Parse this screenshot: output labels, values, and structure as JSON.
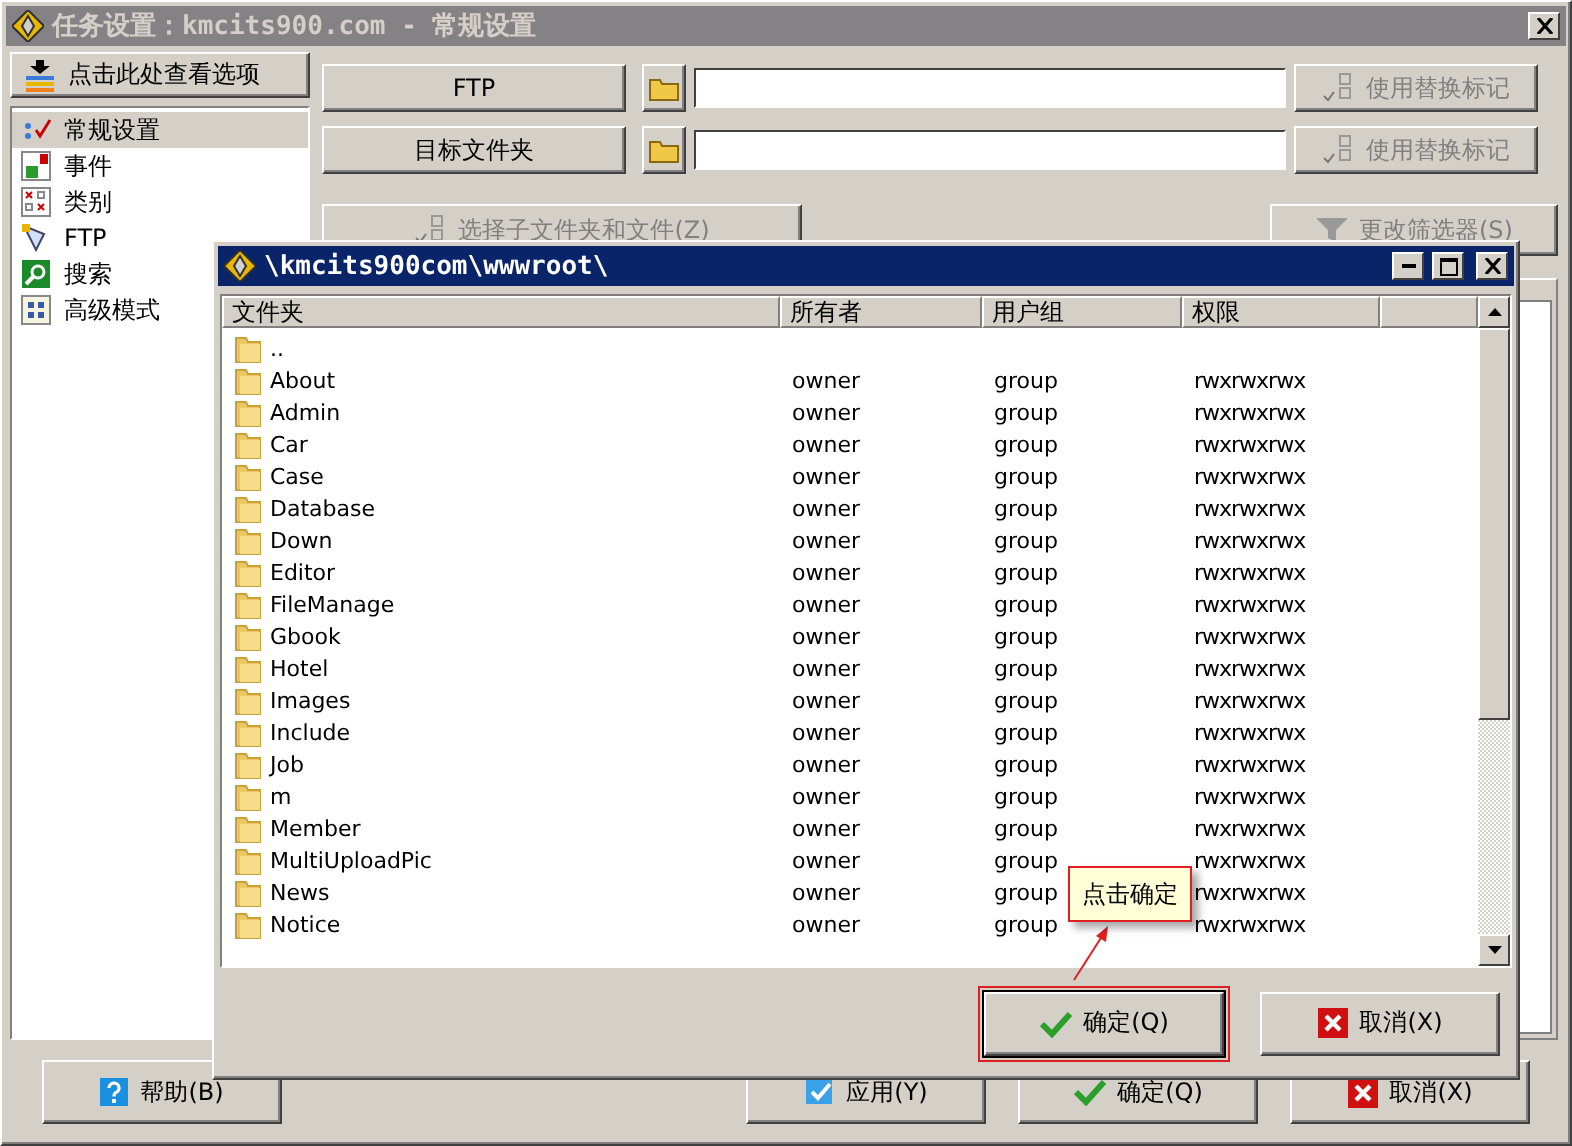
{
  "main_window": {
    "title": "任务设置：kmcits900.com - 常规设置",
    "active": false,
    "options_button": "点击此处查看选项",
    "nav_items": [
      {
        "label": "常规设置",
        "selected": true
      },
      {
        "label": "事件",
        "selected": false
      },
      {
        "label": "类别",
        "selected": false
      },
      {
        "label": "FTP",
        "selected": false
      },
      {
        "label": "搜索",
        "selected": false
      },
      {
        "label": "高级模式",
        "selected": false
      }
    ],
    "fields": [
      {
        "button": "FTP",
        "replace_button": {
          "label": "使用替换标记",
          "disabled": true
        }
      },
      {
        "button": "目标文件夹",
        "replace_button": {
          "label": "使用替换标记",
          "disabled": true
        }
      }
    ],
    "subfolder_button": {
      "label": "选择子文件夹和文件(Z)",
      "disabled": true
    },
    "filter_button": {
      "label": "更改筛选器(S)",
      "disabled": true
    },
    "footer_buttons": [
      {
        "label": "帮助(B)",
        "kind": "help"
      },
      {
        "label": "应用(Y)",
        "kind": "apply"
      },
      {
        "label": "确定(Q)",
        "kind": "ok"
      },
      {
        "label": "取消(X)",
        "kind": "cancel"
      }
    ]
  },
  "dialog": {
    "title": "\\kmcits900com\\wwwroot\\",
    "active": true,
    "columns": [
      "文件夹",
      "所有者",
      "用户组",
      "权限"
    ],
    "rows": [
      {
        "name": ".."
      },
      {
        "name": "About",
        "owner": "owner",
        "group": "group",
        "permissions": "rwxrwxrwx"
      },
      {
        "name": "Admin",
        "owner": "owner",
        "group": "group",
        "permissions": "rwxrwxrwx"
      },
      {
        "name": "Car",
        "owner": "owner",
        "group": "group",
        "permissions": "rwxrwxrwx"
      },
      {
        "name": "Case",
        "owner": "owner",
        "group": "group",
        "permissions": "rwxrwxrwx"
      },
      {
        "name": "Database",
        "owner": "owner",
        "group": "group",
        "permissions": "rwxrwxrwx"
      },
      {
        "name": "Down",
        "owner": "owner",
        "group": "group",
        "permissions": "rwxrwxrwx"
      },
      {
        "name": "Editor",
        "owner": "owner",
        "group": "group",
        "permissions": "rwxrwxrwx"
      },
      {
        "name": "FileManage",
        "owner": "owner",
        "group": "group",
        "permissions": "rwxrwxrwx"
      },
      {
        "name": "Gbook",
        "owner": "owner",
        "group": "group",
        "permissions": "rwxrwxrwx"
      },
      {
        "name": "Hotel",
        "owner": "owner",
        "group": "group",
        "permissions": "rwxrwxrwx"
      },
      {
        "name": "Images",
        "owner": "owner",
        "group": "group",
        "permissions": "rwxrwxrwx"
      },
      {
        "name": "Include",
        "owner": "owner",
        "group": "group",
        "permissions": "rwxrwxrwx"
      },
      {
        "name": "Job",
        "owner": "owner",
        "group": "group",
        "permissions": "rwxrwxrwx"
      },
      {
        "name": "m",
        "owner": "owner",
        "group": "group",
        "permissions": "rwxrwxrwx"
      },
      {
        "name": "Member",
        "owner": "owner",
        "group": "group",
        "permissions": "rwxrwxrwx"
      },
      {
        "name": "MultiUploadPic",
        "owner": "owner",
        "group": "group",
        "permissions": "rwxrwxrwx"
      },
      {
        "name": "News",
        "owner": "owner",
        "group": "group",
        "permissions": "rwxrwxrwx"
      },
      {
        "name": "Notice",
        "owner": "owner",
        "group": "group",
        "permissions": "rwxrwxrwx"
      }
    ],
    "buttons": [
      {
        "label": "确定(Q)",
        "kind": "ok",
        "highlighted": true
      },
      {
        "label": "取消(X)",
        "kind": "cancel",
        "highlighted": false
      }
    ],
    "callout": {
      "text": "点击确定"
    }
  }
}
